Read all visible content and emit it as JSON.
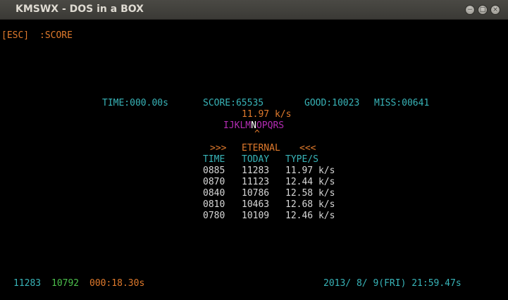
{
  "window": {
    "title": "KMSWX - DOS in a BOX",
    "buttons": {
      "minimize": "−",
      "maximize": "□",
      "close": "×"
    }
  },
  "screen": {
    "esc_label": "[ESC]",
    "esc_action": ":SCORE",
    "stats": {
      "time": "TIME:000.00s",
      "score": "SCORE:65535",
      "good": "GOOD:10023",
      "miss": "MISS:00641"
    },
    "speed": "11.97 k/s",
    "letters": {
      "before": "IJKLM",
      "current": "N",
      "after": "OPQRS"
    },
    "caret": "^",
    "ranking": {
      "title_left": ">>>",
      "title": "ETERNAL",
      "title_right": "<<<",
      "headers": [
        "TIME",
        "TODAY",
        "TYPE/S"
      ],
      "rows": [
        [
          "0885",
          "11283",
          "11.97 k/s"
        ],
        [
          "0870",
          "11123",
          "12.44 k/s"
        ],
        [
          "0840",
          "10786",
          "12.58 k/s"
        ],
        [
          "0810",
          "10463",
          "12.68 k/s"
        ],
        [
          "0780",
          "10109",
          "12.46 k/s"
        ]
      ]
    },
    "footer": {
      "value1": "11283",
      "value2": "10792",
      "elapsed": "000:18.30s",
      "datetime": "2013/ 8/ 9(FRI) 21:59.47s"
    },
    "colors": {
      "background": "#000000",
      "orange": "#e07a2c",
      "cyan": "#38b4b8",
      "white": "#d8d8d8",
      "green": "#4cc04c",
      "magenta": "#b42cb4"
    }
  }
}
